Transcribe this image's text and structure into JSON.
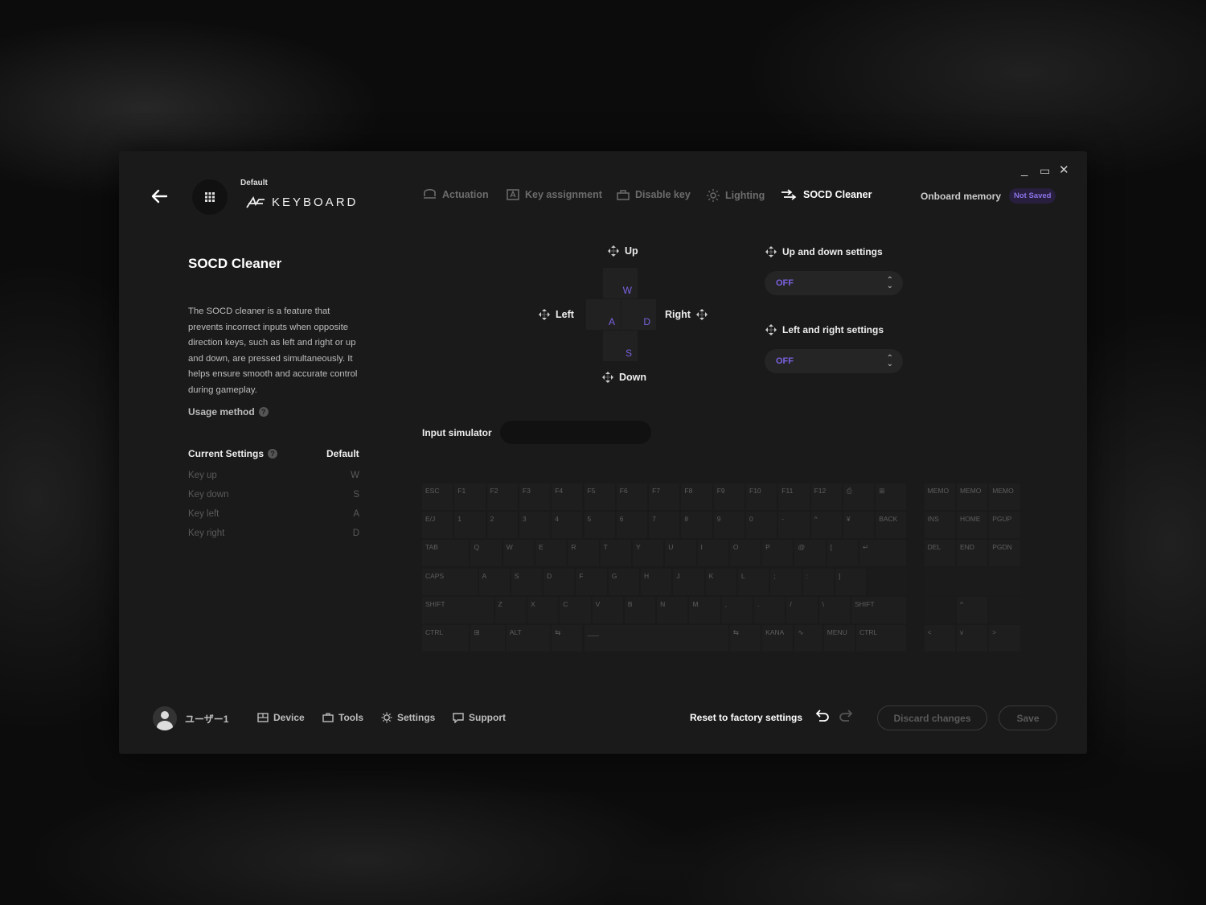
{
  "window": {
    "minimize": "_",
    "maximize": "▭",
    "close": "✕"
  },
  "header": {
    "profile_name": "Default",
    "logo_text": "KEYBOARD",
    "tabs": [
      {
        "label": "Actuation",
        "icon": "actuation-icon"
      },
      {
        "label": "Key assignment",
        "icon": "key-assignment-icon"
      },
      {
        "label": "Disable key",
        "icon": "lock-icon"
      },
      {
        "label": "Lighting",
        "icon": "sun-icon"
      },
      {
        "label": "SOCD Cleaner",
        "icon": "socd-icon",
        "active": true
      }
    ],
    "onboard_label": "Onboard memory",
    "status_badge": "Not Saved"
  },
  "info": {
    "title": "SOCD Cleaner",
    "description": "The SOCD cleaner is a feature that prevents incorrect inputs when opposite direction keys, such as left and right or up and down, are pressed simultaneously. It helps ensure smooth and accurate control during gameplay.",
    "usage_label": "Usage method",
    "current_settings_label": "Current Settings",
    "default_label": "Default",
    "settings": [
      {
        "name": "Key up",
        "value": "W"
      },
      {
        "name": "Key down",
        "value": "S"
      },
      {
        "name": "Key left",
        "value": "A"
      },
      {
        "name": "Key right",
        "value": "D"
      }
    ]
  },
  "dpad": {
    "up_label": "Up",
    "down_label": "Down",
    "left_label": "Left",
    "right_label": "Right",
    "keys": {
      "up": "W",
      "left": "A",
      "right": "D",
      "down": "S"
    }
  },
  "settings_panel": {
    "updown_label": "Up and down settings",
    "updown_value": "OFF",
    "leftright_label": "Left and right settings",
    "leftright_value": "OFF"
  },
  "simulator": {
    "label": "Input simulator"
  },
  "keyboard": {
    "row1": [
      "ESC",
      "F1",
      "F2",
      "F3",
      "F4",
      "F5",
      "F6",
      "F7",
      "F8",
      "F9",
      "F10",
      "F11",
      "F12",
      "⎙",
      "⊞",
      "MEMO",
      "MEMO",
      "MEMO"
    ],
    "row2": [
      "E/J",
      "1",
      "2",
      "3",
      "4",
      "5",
      "6",
      "7",
      "8",
      "9",
      "0",
      "-",
      "^",
      "¥",
      "BACK",
      "INS",
      "HOME",
      "PGUP"
    ],
    "row3": [
      "TAB",
      "Q",
      "W",
      "E",
      "R",
      "T",
      "Y",
      "U",
      "I",
      "O",
      "P",
      "@",
      "[",
      "↵",
      "DEL",
      "END",
      "PGDN"
    ],
    "row4": [
      "CAPS",
      "A",
      "S",
      "D",
      "F",
      "G",
      "H",
      "J",
      "K",
      "L",
      ";",
      ":",
      "]"
    ],
    "row5": [
      "SHIFT",
      "Z",
      "X",
      "C",
      "V",
      "B",
      "N",
      "M",
      ",",
      ".",
      "/",
      "\\",
      "SHIFT",
      "^"
    ],
    "row6": [
      "CTRL",
      "⊞",
      "ALT",
      "⇆",
      "___",
      "⇆",
      "KANA",
      "∿",
      "MENU",
      "CTRL",
      "<",
      "v",
      ">"
    ]
  },
  "footer": {
    "user": "ユーザー1",
    "device": "Device",
    "tools": "Tools",
    "settings": "Settings",
    "support": "Support",
    "reset": "Reset to factory settings",
    "discard": "Discard changes",
    "save": "Save"
  },
  "colors": {
    "accent": "#7b62e0",
    "badge_bg": "#271f3d",
    "window_bg": "#1a1a1a"
  }
}
